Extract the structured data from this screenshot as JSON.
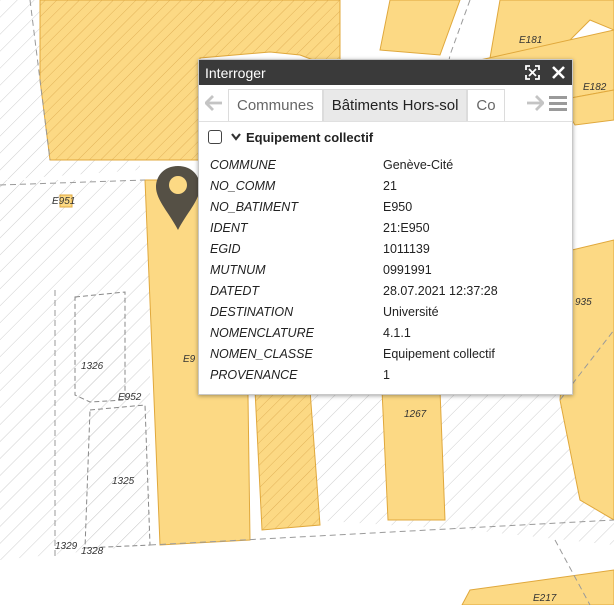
{
  "map": {
    "labels": {
      "e181": "E181",
      "e182": "E182",
      "e951": "E951",
      "e935": "935",
      "e9x": "E9",
      "p1326": "1326",
      "e952": "E952",
      "p1267": "1267",
      "p1325": "1325",
      "p1329": "1329",
      "p1328": "1328",
      "e217": "E217"
    },
    "colors": {
      "building": "#fcd984",
      "building_stroke": "#e0a83c",
      "hatch": "#c7c7c7",
      "pin": "#555045"
    }
  },
  "popup": {
    "title": "Interroger",
    "tabs": [
      "Communes",
      "Bâtiments Hors-sol",
      "Co"
    ],
    "active_tab": "Bâtiments Hors-sol",
    "section_title": "Equipement collectif",
    "attributes": [
      {
        "key": "COMMUNE",
        "value": "Genève-Cité"
      },
      {
        "key": "NO_COMM",
        "value": "21"
      },
      {
        "key": "NO_BATIMENT",
        "value": "E950"
      },
      {
        "key": "IDENT",
        "value": "21:E950"
      },
      {
        "key": "EGID",
        "value": "1011139"
      },
      {
        "key": "MUTNUM",
        "value": "0991991"
      },
      {
        "key": "DATEDT",
        "value": "28.07.2021 12:37:28"
      },
      {
        "key": "DESTINATION",
        "value": "Université"
      },
      {
        "key": "NOMENCLATURE",
        "value": "4.1.1"
      },
      {
        "key": "NOMEN_CLASSE",
        "value": "Equipement collectif"
      },
      {
        "key": "PROVENANCE",
        "value": "1"
      }
    ]
  },
  "icons": {
    "expand": "expand-icon",
    "close": "close-icon",
    "prev": "arrow-left-icon",
    "next": "arrow-right-icon",
    "menu": "hamburger-menu-icon",
    "chevron": "chevron-down-icon",
    "pin": "map-pin-icon"
  }
}
